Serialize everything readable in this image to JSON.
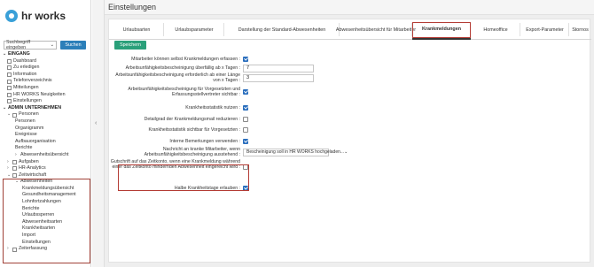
{
  "brand": {
    "name": "hr works"
  },
  "header": {
    "title": "Einstellungen"
  },
  "search": {
    "select_value": "Suchbegriff eingeben",
    "button": "Suchen"
  },
  "sidebar": {
    "items": [
      {
        "label": "EINGANG",
        "level": 0,
        "head": true
      },
      {
        "label": "Dashboard",
        "level": 1
      },
      {
        "label": "Zu erledigen",
        "level": 1
      },
      {
        "label": "Information",
        "level": 1
      },
      {
        "label": "Telefonverzeichnis",
        "level": 1
      },
      {
        "label": "Mitteilungen",
        "level": 1
      },
      {
        "label": "HR WORKS Neuigkeiten",
        "level": 1
      },
      {
        "label": "Einstellungen",
        "level": 1
      },
      {
        "label": "ADMIN UNTERNEHMEN",
        "level": 0,
        "head": true
      },
      {
        "label": "Personen",
        "level": 1,
        "caret": "⌄"
      },
      {
        "label": "Personen",
        "level": 2
      },
      {
        "label": "Organigramm",
        "level": 2
      },
      {
        "label": "Ereignisse",
        "level": 2
      },
      {
        "label": "Aufbauorganisation",
        "level": 2
      },
      {
        "label": "Berichte",
        "level": 2
      },
      {
        "label": "Abwesenheitsübersicht",
        "level": 2,
        "caret": "›"
      },
      {
        "label": "Aufgaben",
        "level": 1,
        "caret": "›"
      },
      {
        "label": "HR-Analytics",
        "level": 1,
        "caret": "›"
      },
      {
        "label": "Zeitwirtschaft",
        "level": 1,
        "caret": "⌄"
      },
      {
        "label": "Abwesenheiten",
        "level": 2,
        "caret": "⌄"
      },
      {
        "label": "Krankmeldungsübersicht",
        "level": 3
      },
      {
        "label": "Gesundheitsmanagement",
        "level": 3
      },
      {
        "label": "Lohnfortzahlungen",
        "level": 3
      },
      {
        "label": "Berichte",
        "level": 3
      },
      {
        "label": "Urlaubssperren",
        "level": 3
      },
      {
        "label": "Abwesenheitsarten",
        "level": 3
      },
      {
        "label": "Krankheitsarten",
        "level": 3
      },
      {
        "label": "Import",
        "level": 3
      },
      {
        "label": "Einstellungen",
        "level": 3
      },
      {
        "label": "Zeiterfassung",
        "level": 1,
        "caret": "›"
      }
    ]
  },
  "tabs": [
    {
      "label": "Urlaubsarten"
    },
    {
      "label": "Urlaubsparameter"
    },
    {
      "label": "Darstellung der Standard-Abwesenheiten"
    },
    {
      "label": "Abwesenheitsübersicht für Mitarbeiter"
    },
    {
      "label": "Krankmeldungen",
      "active": true
    },
    {
      "label": "Homeoffice"
    },
    {
      "label": "Export-Parameter"
    },
    {
      "label": "Stornos"
    }
  ],
  "save_label": "Speichern",
  "settings": [
    {
      "label": "Mitarbeiter können selbst Krankmeldungen erfassen :",
      "control": "checkbox",
      "checked": true
    },
    {
      "label": "Arbeitsunfähigkeitsbescheinigung überfällig ab x Tagen :",
      "control": "number",
      "value": "7"
    },
    {
      "label": "Arbeitsunfähigkeitsbescheinigung erforderlich ab einer Länge von x Tagen :",
      "control": "number",
      "value": "3"
    },
    {
      "label": "Arbeitsunfähigkeitsbescheinigung für Vorgesetzten und Erfassungsstellvertreter sichtbar :",
      "control": "checkbox",
      "checked": true
    },
    {
      "label": "Krankheitsstatistik nutzen :",
      "control": "checkbox",
      "checked": true
    },
    {
      "label": "Detailgrad der Krankmeldungsmail reduzieren :",
      "control": "checkbox",
      "checked": false
    },
    {
      "label": "Krankheitsstatistik sichtbar für Vorgesetzten :",
      "control": "checkbox",
      "checked": false
    },
    {
      "label": "Interne Bemerkungen verwenden :",
      "control": "checkbox",
      "checked": true
    },
    {
      "label": "Nachricht an kranke Mitarbeiter, wenn Arbeitsunfähigkeitsbescheinigung ausstehend :",
      "control": "select",
      "value": "Bescheinigung soll in HR WORKS hochgeladen..."
    },
    {
      "label": "Gutschrift auf das Zeitkonto, wenn eine Krankmeldung während einer das Zeitkonto mindernden Abwesenheit eingereicht wird :",
      "control": "checkbox",
      "checked": false
    },
    {
      "label": "Halbe Krankheitstage erlauben :",
      "control": "checkbox",
      "checked": true
    }
  ]
}
